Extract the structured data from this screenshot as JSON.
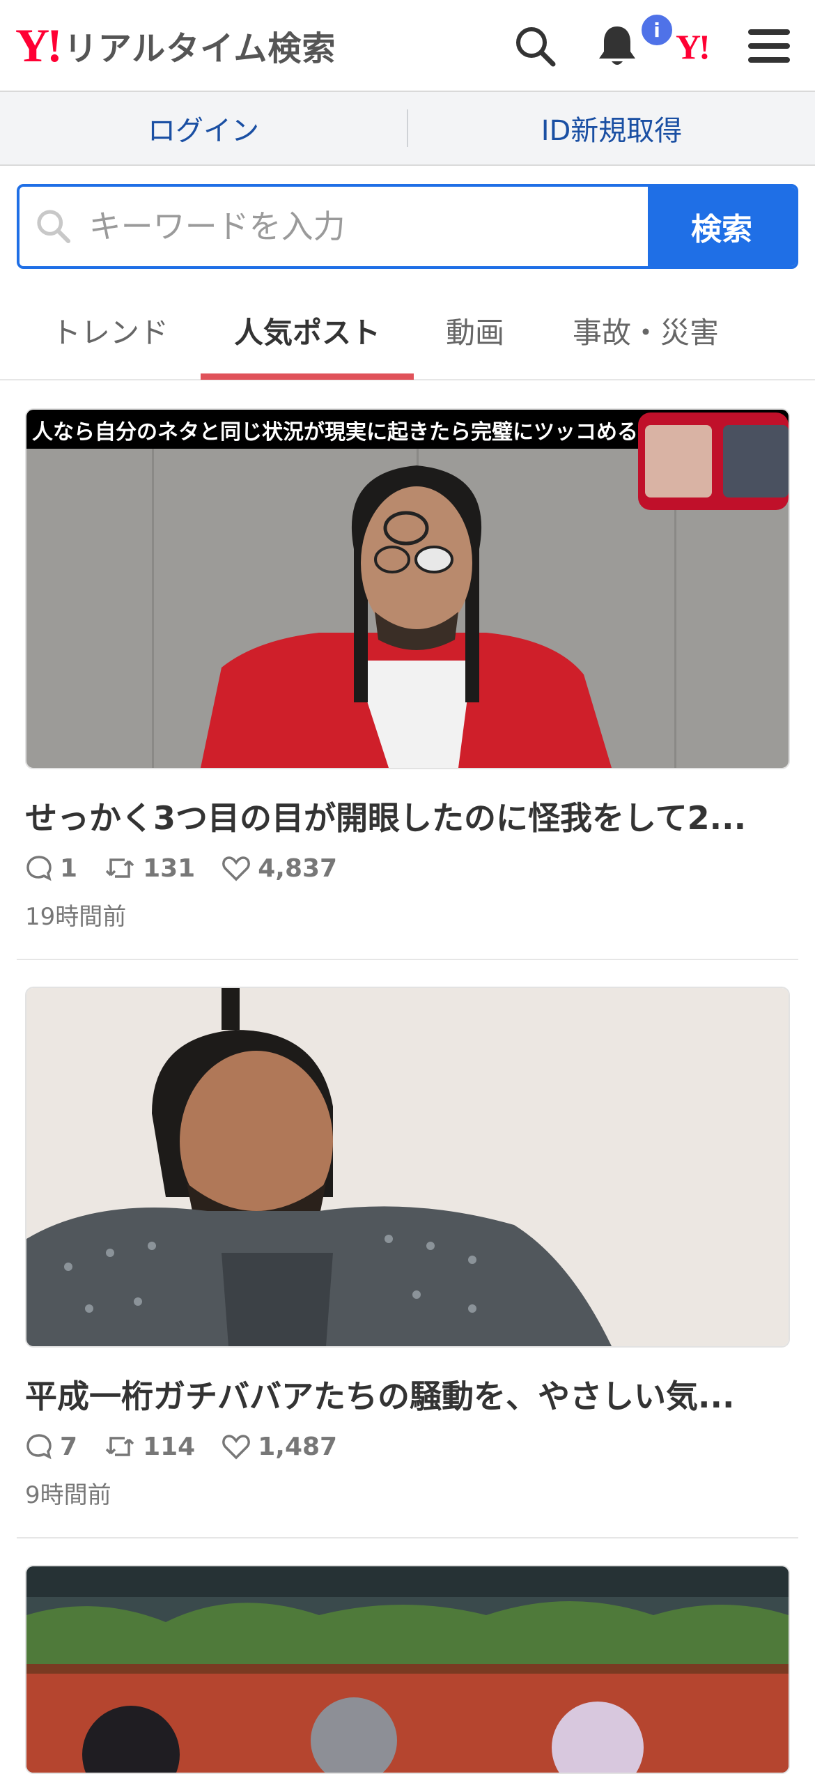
{
  "header": {
    "logo_mark": "Y!",
    "logo_text": "リアルタイム検索",
    "notification_badge": "i",
    "yj_mark": "Y!"
  },
  "auth": {
    "login_label": "ログイン",
    "register_label": "ID新規取得"
  },
  "search": {
    "placeholder": "キーワードを入力",
    "button_label": "検索"
  },
  "tabs": [
    {
      "label": "トレンド",
      "active": false
    },
    {
      "label": "人気ポスト",
      "active": true
    },
    {
      "label": "動画",
      "active": false
    },
    {
      "label": "事故・災害",
      "active": false
    }
  ],
  "posts": [
    {
      "caption": "人なら自分のネタと同じ状況が現実に起きたら完璧にツッコめる説",
      "title": "せっかく3つ目の目が開眼したのに怪我をして2...",
      "replies": "1",
      "reposts": "131",
      "likes": "4,837",
      "time": "19時間前"
    },
    {
      "title": "平成一桁ガチババアたちの騒動を、やさしい気...",
      "replies": "7",
      "reposts": "114",
      "likes": "1,487",
      "time": "9時間前"
    }
  ],
  "colors": {
    "brand_red": "#ff0033",
    "accent_blue": "#1f6fe6",
    "tab_underline": "#e0525a",
    "link_blue": "#1a4fa3"
  }
}
